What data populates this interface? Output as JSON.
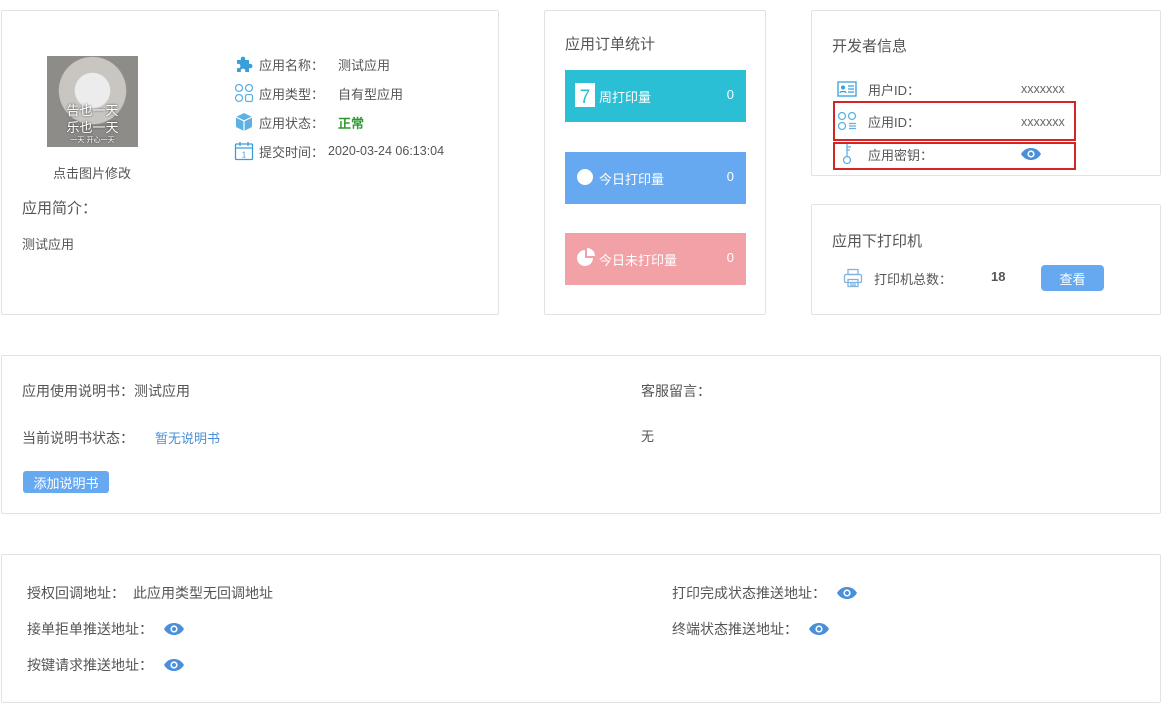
{
  "app": {
    "avatar_caption": [
      "告也一天",
      "乐也一天",
      "一天 开心一天"
    ],
    "avatar_hint": "点击图片修改",
    "name_label": "应用名称：",
    "name_value": "测试应用",
    "type_label": "应用类型：",
    "type_value": "自有型应用",
    "status_label": "应用状态：",
    "status_value": "正常",
    "submit_label": "提交时间：",
    "submit_value": "2020-03-24 06:13:04",
    "intro_label": "应用简介：",
    "intro_text": "测试应用",
    "icons": [
      "puzzle-icon",
      "app-type-icon",
      "box-icon",
      "calendar-icon"
    ]
  },
  "orders": {
    "title": "应用订单统计",
    "items": [
      {
        "label": "周打印量",
        "value": "0",
        "color": "#2bbfd6",
        "icon": "calendar-seven-icon"
      },
      {
        "label": "今日打印量",
        "value": "0",
        "color": "#66a9f1",
        "icon": "circle-icon"
      },
      {
        "label": "今日未打印量",
        "value": "0",
        "color": "#f2a1a6",
        "icon": "pie-icon"
      }
    ]
  },
  "developer": {
    "title": "开发者信息",
    "user_id_label": "用户ID：",
    "user_id_value": "xxxxxxx",
    "app_id_label": "应用ID：",
    "app_id_value": "xxxxxxx",
    "secret_label": "应用密钥：",
    "highlight_color": "#d42424"
  },
  "printers": {
    "title": "应用下打印机",
    "total_label": "打印机总数：",
    "total_value": "18",
    "view_button": "查看"
  },
  "manual": {
    "title": "应用使用说明书：测试应用",
    "status_label": "当前说明书状态：",
    "status_value": "暂无说明书",
    "add_button": "添加说明书",
    "service_label": "客服留言：",
    "service_value": "无"
  },
  "callbacks": {
    "auth_label": "授权回调地址：",
    "auth_value": "此应用类型无回调地址",
    "accept_label": "接单拒单推送地址：",
    "key_label": "按键请求推送地址：",
    "print_done_label": "打印完成状态推送地址：",
    "terminal_label": "终端状态推送地址："
  },
  "colors": {
    "accent": "#66a9f1",
    "status_ok": "#2e9a2e",
    "eye": "#4a90d9"
  }
}
